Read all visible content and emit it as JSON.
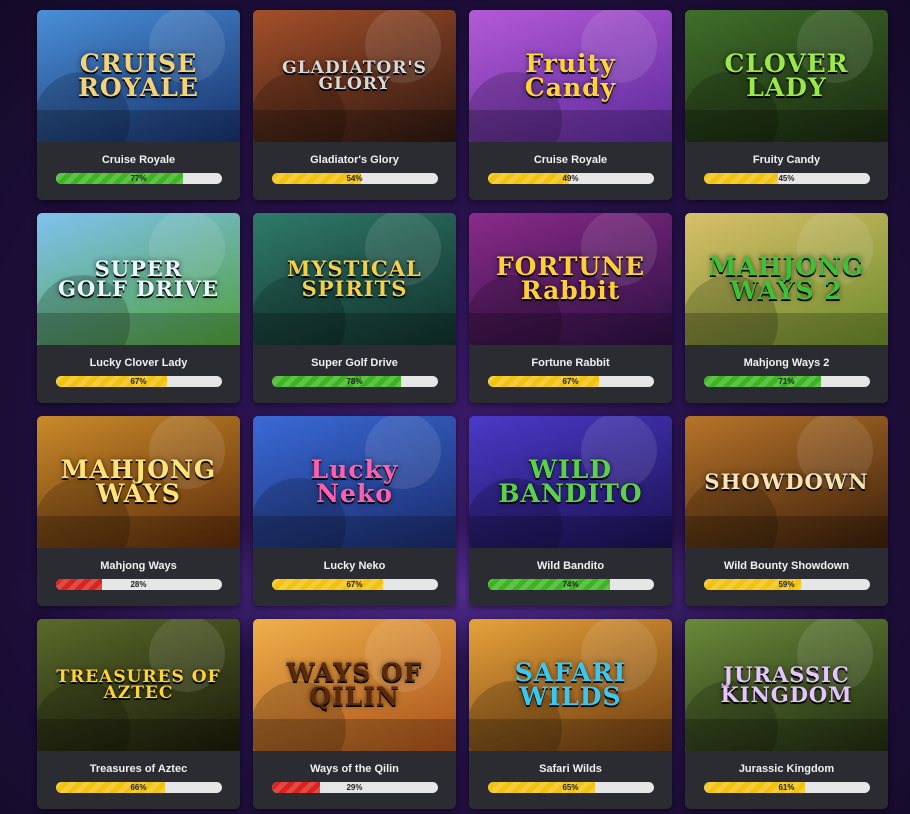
{
  "games": [
    {
      "name": "Cruise Royale",
      "logo": "CRUISE\nROYALE",
      "percent": 77,
      "percent_label": "77%",
      "bar_color": "#3cb521",
      "colors": [
        "#4a8fd8",
        "#17316a"
      ],
      "logo_color": "#f3d37a"
    },
    {
      "name": "Gladiator's Glory",
      "logo": "GLADIATOR'S\nGLORY",
      "percent": 54,
      "percent_label": "54%",
      "bar_color": "#f2c20f",
      "colors": [
        "#a4502a",
        "#2c1710"
      ],
      "logo_color": "#d8d8d8"
    },
    {
      "name": "Cruise Royale",
      "logo": "Fruity\nCandy",
      "percent": 49,
      "percent_label": "49%",
      "bar_color": "#f2c20f",
      "colors": [
        "#b45ad6",
        "#5a2a9a"
      ],
      "logo_color": "#ffd23a"
    },
    {
      "name": "Fruity Candy",
      "logo": "CLOVER\nLADY",
      "percent": 45,
      "percent_label": "45%",
      "bar_color": "#f2c20f",
      "colors": [
        "#3f6f2a",
        "#1a2810"
      ],
      "logo_color": "#9be84a"
    },
    {
      "name": "Lucky Clover Lady",
      "logo": "SUPER\nGOLF DRIVE",
      "percent": 67,
      "percent_label": "67%",
      "bar_color": "#f2c20f",
      "colors": [
        "#7fc2f0",
        "#4fa03a"
      ],
      "logo_color": "#eaf7ff"
    },
    {
      "name": "Super Golf Drive",
      "logo": "MYSTICAL\nSPIRITS",
      "percent": 78,
      "percent_label": "78%",
      "bar_color": "#3cb521",
      "colors": [
        "#2f7a6a",
        "#11302a"
      ],
      "logo_color": "#f3d04a"
    },
    {
      "name": "Fortune Rabbit",
      "logo": "FORTUNE\nRabbit",
      "percent": 67,
      "percent_label": "67%",
      "bar_color": "#f2c20f",
      "colors": [
        "#8a2a8a",
        "#2a1040"
      ],
      "logo_color": "#ffcf3a"
    },
    {
      "name": "Mahjong Ways 2",
      "logo": "MAHJONG\nWAYS 2",
      "percent": 71,
      "percent_label": "71%",
      "bar_color": "#3cb521",
      "colors": [
        "#d9c06a",
        "#6a8a2a"
      ],
      "logo_color": "#3fbf3a"
    },
    {
      "name": "Mahjong Ways",
      "logo": "MAHJONG\nWAYS",
      "percent": 28,
      "percent_label": "28%",
      "bar_color": "#d9231c",
      "colors": [
        "#c98a2a",
        "#5a2a0a"
      ],
      "logo_color": "#ffe27a"
    },
    {
      "name": "Lucky Neko",
      "logo": "Lucky\nNeko",
      "percent": 67,
      "percent_label": "67%",
      "bar_color": "#f2c20f",
      "colors": [
        "#3a6ad6",
        "#1a2a6a"
      ],
      "logo_color": "#ff5fb0"
    },
    {
      "name": "Wild Bandito",
      "logo": "WILD\nBANDITO",
      "percent": 74,
      "percent_label": "74%",
      "bar_color": "#3cb521",
      "colors": [
        "#4a3ac8",
        "#1a1050"
      ],
      "logo_color": "#5ad14a"
    },
    {
      "name": "Wild Bounty Showdown",
      "logo": "SHOWDOWN",
      "percent": 59,
      "percent_label": "59%",
      "bar_color": "#f2c20f",
      "colors": [
        "#b7742a",
        "#3a1e0a"
      ],
      "logo_color": "#f7e3b5"
    },
    {
      "name": "Treasures of Aztec",
      "logo": "TREASURES OF\nAZTEC",
      "percent": 66,
      "percent_label": "66%",
      "bar_color": "#f2c20f",
      "colors": [
        "#5a6a2a",
        "#1a1a0a"
      ],
      "logo_color": "#ffd23a"
    },
    {
      "name": "Ways of the Qilin",
      "logo": "WAYS OF\nQILIN",
      "percent": 29,
      "percent_label": "29%",
      "bar_color": "#d9231c",
      "colors": [
        "#f0b04a",
        "#a8501a"
      ],
      "logo_color": "#5a2a0a"
    },
    {
      "name": "Safari Wilds",
      "logo": "SAFARI\nWILDS",
      "percent": 65,
      "percent_label": "65%",
      "bar_color": "#f2c20f",
      "colors": [
        "#e7a23a",
        "#6a3a10"
      ],
      "logo_color": "#3ac8f0"
    },
    {
      "name": "Jurassic Kingdom",
      "logo": "JURASSIC\nKINGDOM",
      "percent": 61,
      "percent_label": "61%",
      "bar_color": "#f2c20f",
      "colors": [
        "#6a8a3a",
        "#1f2a10"
      ],
      "logo_color": "#e6c4ff"
    }
  ]
}
